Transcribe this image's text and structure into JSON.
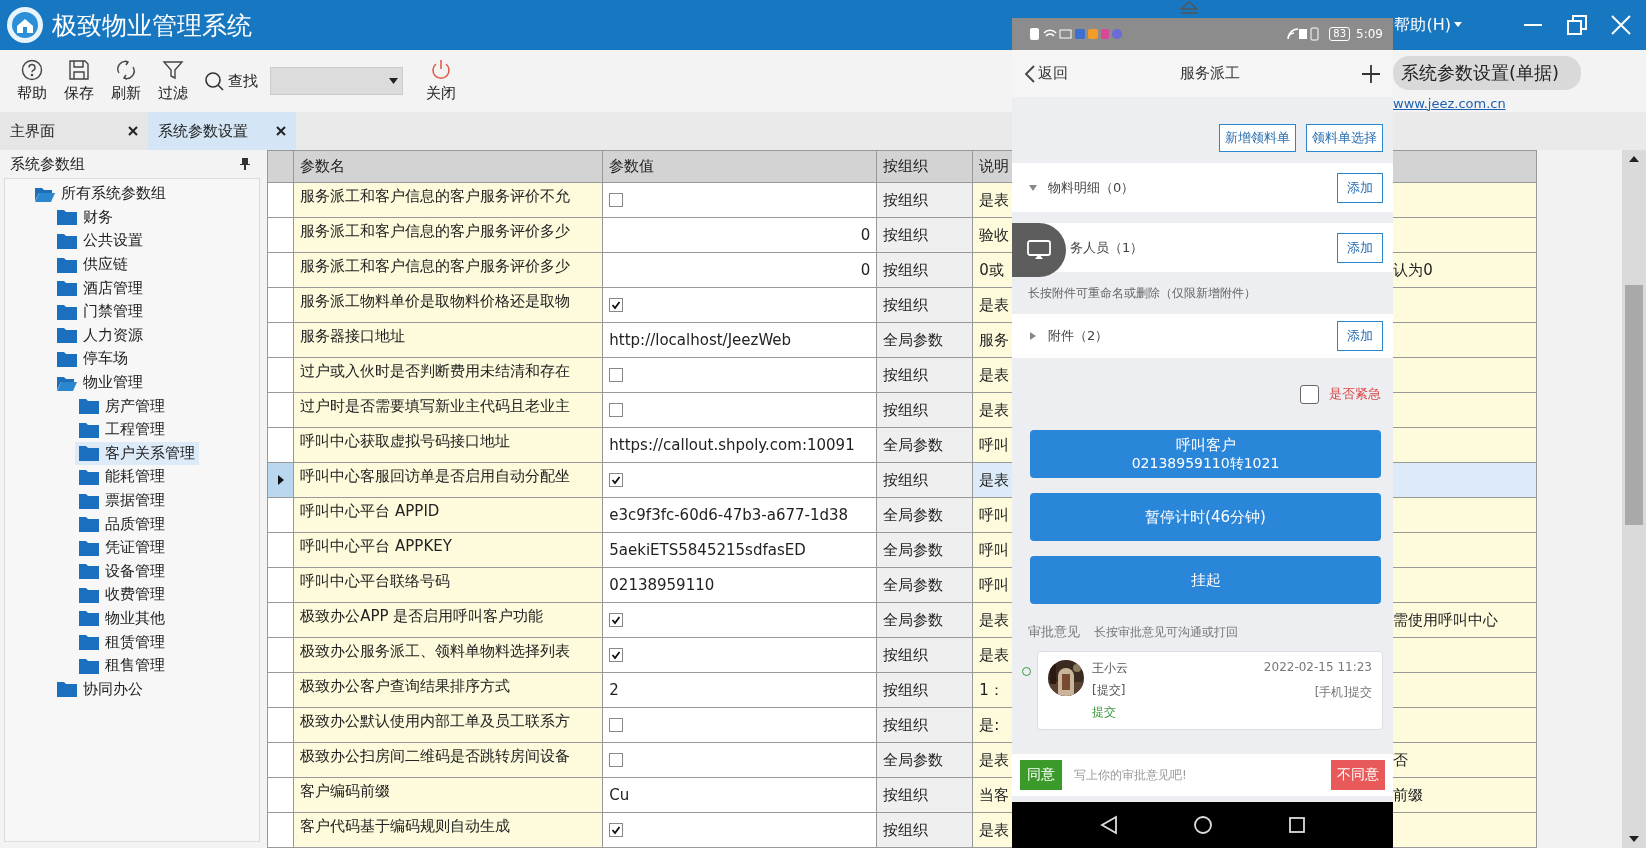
{
  "window": {
    "title": "极致物业管理系统",
    "menu_item": "帮助(H)"
  },
  "toolbar": {
    "buttons": [
      {
        "label": "帮助",
        "kind": "help"
      },
      {
        "label": "保存",
        "kind": "save"
      },
      {
        "label": "刷新",
        "kind": "refresh"
      },
      {
        "label": "过滤",
        "kind": "filter"
      }
    ],
    "search_label": "查找",
    "close_label": "关闭",
    "form_title": "系统参数设置(单据)",
    "link": "www.jeez.com.cn"
  },
  "tabs": [
    {
      "label": "主界面",
      "selected": false
    },
    {
      "label": "系统参数设置",
      "selected": true
    }
  ],
  "sidebar": {
    "title": "系统参数组",
    "tree": [
      {
        "label": "所有系统参数组",
        "selected": false,
        "expanded": true,
        "children": [
          {
            "label": "财务",
            "selected": false
          },
          {
            "label": "公共设置",
            "selected": false
          },
          {
            "label": "供应链",
            "selected": false
          },
          {
            "label": "酒店管理",
            "selected": false
          },
          {
            "label": "门禁管理",
            "selected": false
          },
          {
            "label": "人力资源",
            "selected": false
          },
          {
            "label": "停车场",
            "selected": false
          },
          {
            "label": "物业管理",
            "selected": false,
            "expanded": true,
            "children": [
              {
                "label": "房产管理",
                "selected": false
              },
              {
                "label": "工程管理",
                "selected": false
              },
              {
                "label": "客户关系管理",
                "selected": true
              },
              {
                "label": "能耗管理",
                "selected": false
              },
              {
                "label": "票据管理",
                "selected": false
              },
              {
                "label": "品质管理",
                "selected": false
              },
              {
                "label": "凭证管理",
                "selected": false
              },
              {
                "label": "设备管理",
                "selected": false
              },
              {
                "label": "收费管理",
                "selected": false
              },
              {
                "label": "物业其他",
                "selected": false
              },
              {
                "label": "租赁管理",
                "selected": false
              },
              {
                "label": "租售管理",
                "selected": false
              }
            ]
          },
          {
            "label": "协同办公",
            "selected": false
          }
        ]
      }
    ]
  },
  "table": {
    "columns": [
      "参数名",
      "参数值",
      "按组织",
      "说明"
    ],
    "rows": [
      {
        "name": "服务派工和客户信息的客户服务评价不允",
        "kind": "checkbox",
        "checked": false,
        "scope": "按组织",
        "note": "是表",
        "selected": false
      },
      {
        "name": "服务派工和客户信息的客户服务评价多少",
        "kind": "number",
        "value": "0",
        "scope": "按组织",
        "note": "验收",
        "selected": false
      },
      {
        "name": "服务派工和客户信息的客户服务评价多少",
        "kind": "number",
        "value": "0",
        "scope": "按组织",
        "note": "0或",
        "note_tail": "认为0",
        "selected": false
      },
      {
        "name": "服务派工物料单价是取物料价格还是取物",
        "kind": "checkbox",
        "checked": true,
        "scope": "按组织",
        "note": "是表",
        "selected": false
      },
      {
        "name": "服务器接口地址",
        "kind": "text",
        "value": "http://localhost/JeezWeb",
        "scope": "全局参数",
        "note": "服务",
        "selected": false
      },
      {
        "name": "过户或入伙时是否判断费用未结清和存在",
        "kind": "checkbox",
        "checked": false,
        "scope": "按组织",
        "note": "是表",
        "selected": false
      },
      {
        "name": "过户时是否需要填写新业主代码且老业主",
        "kind": "checkbox",
        "checked": false,
        "scope": "按组织",
        "note": "是表",
        "selected": false
      },
      {
        "name": "呼叫中心获取虚拟号码接口地址",
        "kind": "text",
        "value": "https://callout.shpoly.com:10091",
        "scope": "全局参数",
        "note": "呼叫",
        "selected": false
      },
      {
        "name": "呼叫中心客服回访单是否启用自动分配坐",
        "kind": "checkbox",
        "checked": true,
        "scope": "按组织",
        "note": "是表",
        "selected": true
      },
      {
        "name": "呼叫中心平台 APPID",
        "kind": "text",
        "value": "e3c9f3fc-60d6-47b3-a677-1d38",
        "scope": "全局参数",
        "note": "呼叫",
        "selected": false
      },
      {
        "name": "呼叫中心平台 APPKEY",
        "kind": "text",
        "value": "5aekiETS5845215sdfasED",
        "scope": "全局参数",
        "note": "呼叫",
        "selected": false
      },
      {
        "name": "呼叫中心平台联络号码",
        "kind": "text",
        "value": "02138959110",
        "scope": "全局参数",
        "note": "呼叫",
        "selected": false
      },
      {
        "name": "极致办公APP 是否启用呼叫客户功能",
        "kind": "checkbox",
        "checked": true,
        "scope": "全局参数",
        "note": "是表",
        "note_tail": "需使用呼叫中心",
        "selected": false
      },
      {
        "name": "极致办公服务派工、领料单物料选择列表",
        "kind": "checkbox",
        "checked": true,
        "scope": "按组织",
        "note": "是表",
        "selected": false
      },
      {
        "name": "极致办公客户查询结果排序方式",
        "kind": "text",
        "value": "2",
        "scope": "按组织",
        "note": "1：",
        "selected": false
      },
      {
        "name": "极致办公默认使用内部工单及员工联系方",
        "kind": "checkbox",
        "checked": false,
        "scope": "按组织",
        "note": "是:",
        "selected": false
      },
      {
        "name": "极致办公扫房间二维码是否跳转房间设备",
        "kind": "checkbox",
        "checked": false,
        "scope": "全局参数",
        "note": "是表",
        "note_tail": "否",
        "selected": false
      },
      {
        "name": "客户编码前缀",
        "kind": "text",
        "value": "Cu",
        "scope": "按组织",
        "note": "当客",
        "note_tail": "前缀",
        "selected": false
      },
      {
        "name": "客户代码基于编码规则自动生成",
        "kind": "checkbox",
        "checked": true,
        "scope": "按组织",
        "note": "是表",
        "selected": false
      }
    ]
  },
  "phone": {
    "battery": "83",
    "time": "5:09",
    "back": "返回",
    "title": "服务派工",
    "top_buttons": [
      "新增领料单",
      "领料单选择"
    ],
    "sections": [
      {
        "label": "物料明细（0）",
        "expanded": true,
        "action": "添加"
      },
      {
        "label": "务人员（1）",
        "action": "添加"
      },
      {
        "label": "附件（2）",
        "expanded": false,
        "action": "添加"
      }
    ],
    "hint": "长按附件可重命名或删除（仅限新增附件）",
    "urgent": {
      "label": "是否紧急",
      "checked": false
    },
    "actions": [
      {
        "label": "呼叫客户",
        "sub": "02138959110转1021"
      },
      {
        "label": "暂停计时(46分钟)"
      },
      {
        "label": "挂起"
      }
    ],
    "approval": {
      "title": "审批意见",
      "hint": "长按审批意见可沟通或打回",
      "entries": [
        {
          "name": "王小云",
          "action": "[提交]",
          "result": "提交",
          "time": "2022-02-15 11:23",
          "source": "[手机]提交"
        }
      ]
    },
    "footer": {
      "agree": "同意",
      "placeholder": "写上你的审批意见吧!",
      "disagree": "不同意"
    }
  }
}
